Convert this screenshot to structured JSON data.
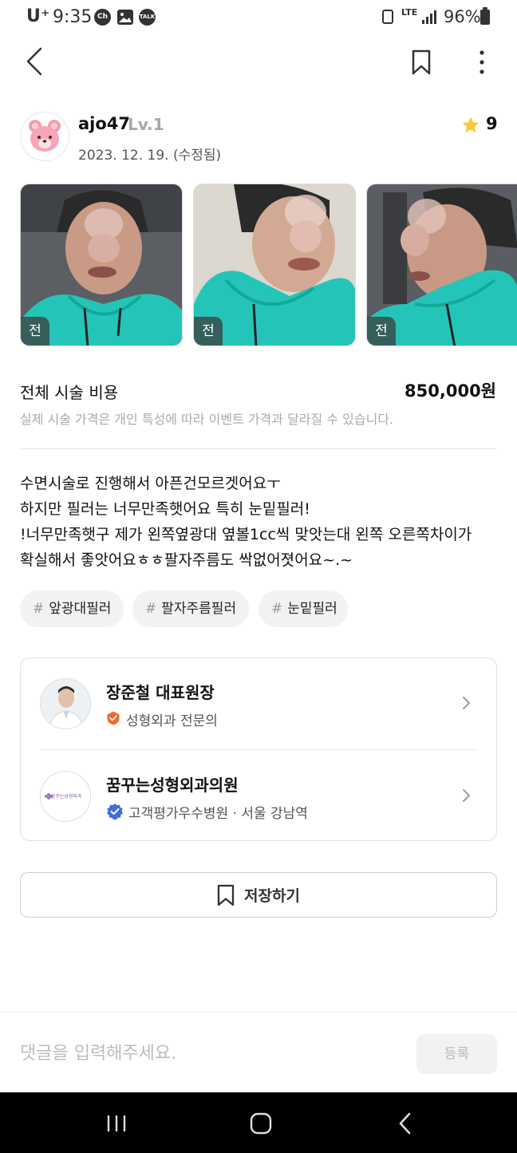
{
  "status_bar": {
    "carrier": "U⁺",
    "time": "9:35",
    "app_badges": [
      "Ch",
      "TALK"
    ],
    "network": "LTE",
    "battery": "96%"
  },
  "author": {
    "username": "ajo47",
    "level": "Lv.1",
    "date": "2023. 12. 19. (수정됨)",
    "rating": "9"
  },
  "photos": [
    {
      "tag": "전"
    },
    {
      "tag": "전"
    },
    {
      "tag": "전"
    }
  ],
  "price": {
    "label": "전체 시술 비용",
    "value": "850,000원",
    "note": "실제 시술 가격은 개인 특성에 따라 이벤트 가격과 달라질 수 있습니다."
  },
  "body_lines": [
    "수면시술로 진행해서 아픈건모르겟어요ㅜ",
    "하지만 필러는 너무만족햇어요 특히 눈밑필러!",
    "!너무만족햇구 제가 왼쪽옆광대 옆볼1cc씩 맞앗는대 왼쪽 오른쪽차이가",
    "확실해서 좋앗어요ㅎㅎ팔자주름도 싹없어졋어요~.~"
  ],
  "tags": [
    {
      "hash": "#",
      "label": "앞광대필러"
    },
    {
      "hash": "#",
      "label": "팔자주름필러"
    },
    {
      "hash": "#",
      "label": "눈밑필러"
    }
  ],
  "doctor": {
    "name": "장준철 대표원장",
    "title": "성형외과 전문의"
  },
  "hospital": {
    "name": "꿈꾸는성형외과의원",
    "info": "고객평가우수병원 · 서울 강남역",
    "logo_text": "꿈꾸는성형외과"
  },
  "save_button": {
    "label": "저장하기"
  },
  "comment": {
    "placeholder": "댓글을 입력해주세요.",
    "submit_label": "등록"
  },
  "colors": {
    "star": "#FFC93C",
    "doctor_badge": "#F26A2E",
    "hospital_badge": "#3D6FE0",
    "photo_bg": "#1ABC9C"
  }
}
